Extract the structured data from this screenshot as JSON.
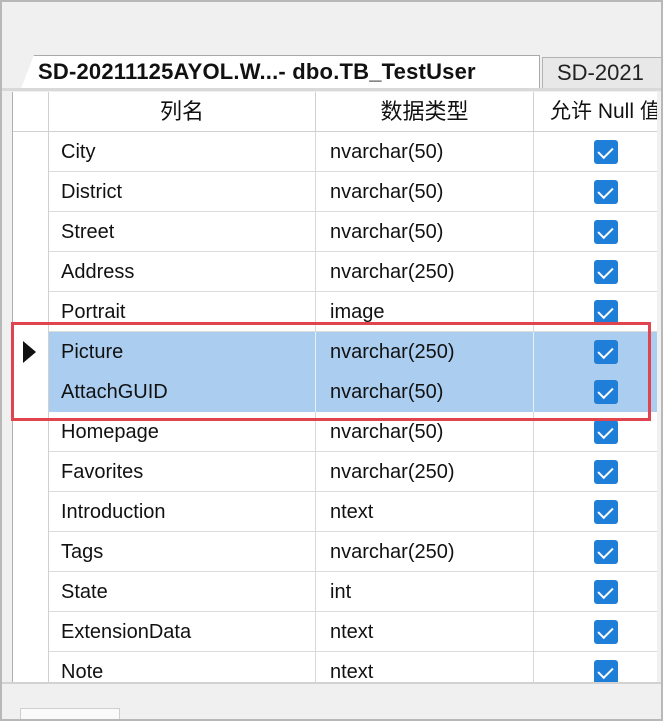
{
  "tabs": [
    {
      "label": "SD-20211125AYOL.W...- dbo.TB_TestUser",
      "active": true
    },
    {
      "label": "SD-2021",
      "active": false
    }
  ],
  "columns_header": {
    "column_name": "列名",
    "data_type": "数据类型",
    "allow_null": "允许 Null 值"
  },
  "rows": [
    {
      "name": "City",
      "type": "nvarchar(50)",
      "allow_null": true
    },
    {
      "name": "District",
      "type": "nvarchar(50)",
      "allow_null": true
    },
    {
      "name": "Street",
      "type": "nvarchar(50)",
      "allow_null": true
    },
    {
      "name": "Address",
      "type": "nvarchar(250)",
      "allow_null": true
    },
    {
      "name": "Portrait",
      "type": "image",
      "allow_null": true
    },
    {
      "name": "Picture",
      "type": "nvarchar(250)",
      "allow_null": true,
      "selected": true,
      "current": true
    },
    {
      "name": "AttachGUID",
      "type": "nvarchar(50)",
      "allow_null": true,
      "selected": true
    },
    {
      "name": "Homepage",
      "type": "nvarchar(50)",
      "allow_null": true
    },
    {
      "name": "Favorites",
      "type": "nvarchar(250)",
      "allow_null": true
    },
    {
      "name": "Introduction",
      "type": "ntext",
      "allow_null": true
    },
    {
      "name": "Tags",
      "type": "nvarchar(250)",
      "allow_null": true
    },
    {
      "name": "State",
      "type": "int",
      "allow_null": true
    },
    {
      "name": "ExtensionData",
      "type": "ntext",
      "allow_null": true
    },
    {
      "name": "Note",
      "type": "ntext",
      "allow_null": true
    }
  ],
  "colors": {
    "selection": "#aacdf0",
    "checkbox": "#1f7fd8",
    "highlight_border": "#e0454f"
  }
}
